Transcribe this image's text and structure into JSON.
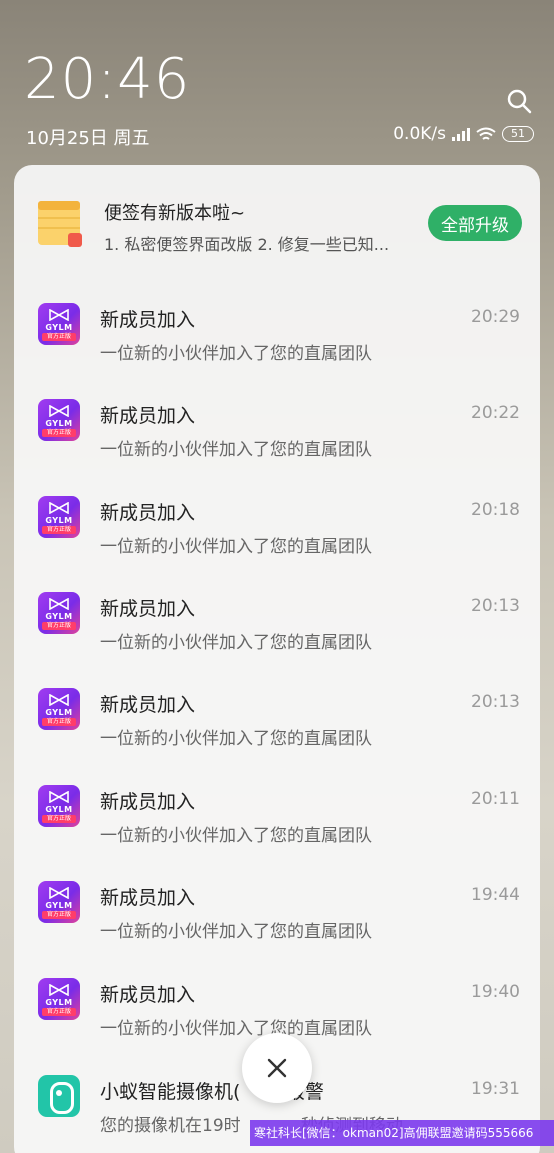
{
  "status_bar": {
    "time": "20:46",
    "date": "10月25日 周五",
    "network_speed": "0.0K/s",
    "battery": "51",
    "search_icon": "search-icon",
    "wifi_icon": "wifi-icon",
    "signal_icon": "signal-icon"
  },
  "notifications": {
    "update_card": {
      "title": "便签有新版本啦~",
      "text": "1. 私密便签界面改版 2. 修复一些已知...",
      "button_label": "全部升级",
      "icon": "notes-app-icon",
      "accent": "#2fb067"
    },
    "items": [
      {
        "title": "新成员加入",
        "text": "一位新的小伙伴加入了您的直属团队",
        "time": "20:29"
      },
      {
        "title": "新成员加入",
        "text": "一位新的小伙伴加入了您的直属团队",
        "time": "20:22"
      },
      {
        "title": "新成员加入",
        "text": "一位新的小伙伴加入了您的直属团队",
        "time": "20:18"
      },
      {
        "title": "新成员加入",
        "text": "一位新的小伙伴加入了您的直属团队",
        "time": "20:13"
      },
      {
        "title": "新成员加入",
        "text": "一位新的小伙伴加入了您的直属团队",
        "time": "20:13"
      },
      {
        "title": "新成员加入",
        "text": "一位新的小伙伴加入了您的直属团队",
        "time": "20:11"
      },
      {
        "title": "新成员加入",
        "text": "一位新的小伙伴加入了您的直属团队",
        "time": "19:44"
      },
      {
        "title": "新成员加入",
        "text": "一位新的小伙伴加入了您的直属团队",
        "time": "19:40"
      }
    ],
    "app_icon_text": "GYLM",
    "app_icon_band": "官方正版",
    "camera_item": {
      "title": "小蚁智能摄像机(",
      "title_rest": ")报警",
      "text": "您的摄像机在19时",
      "text_rest": "秒侦测到移动",
      "time": "19:31"
    }
  },
  "dismiss_all": {
    "icon": "close-icon"
  },
  "watermark": {
    "text": "寒社科长[微信：okman02]高佣联盟邀请码555666"
  }
}
